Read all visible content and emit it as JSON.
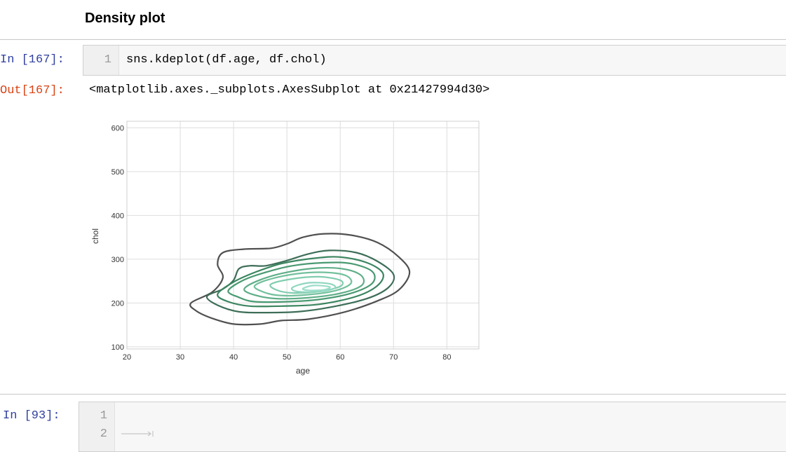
{
  "markdown": {
    "heading": "Density plot"
  },
  "cell_167": {
    "in_prompt": "In [167]:",
    "line_numbers": [
      "1"
    ],
    "code": "sns.kdeplot(df.age, df.chol)",
    "out_prompt": "Out[167]:",
    "output_text": "<matplotlib.axes._subplots.AxesSubplot at 0x21427994d30>"
  },
  "cell_93": {
    "in_prompt": "In [93]:",
    "line_numbers": [
      "1",
      "2"
    ],
    "code_lines": [
      "",
      ""
    ]
  },
  "colors": {
    "in_prompt": "#303f9f",
    "out_prompt": "#d84315",
    "contour_outer": "#505050",
    "contour_inner": "#8fd6c0"
  },
  "chart_data": {
    "type": "kde-contour",
    "title": "",
    "xlabel": "age",
    "ylabel": "chol",
    "xlim": [
      20,
      86
    ],
    "ylim": [
      95,
      615
    ],
    "xticks": [
      20,
      30,
      40,
      50,
      60,
      70,
      80
    ],
    "yticks": [
      100,
      200,
      300,
      400,
      500,
      600
    ],
    "grid": true,
    "contours": [
      {
        "level": 1,
        "color": "#505050",
        "points": [
          [
            32,
            200
          ],
          [
            36,
            225
          ],
          [
            38,
            258
          ],
          [
            37,
            288
          ],
          [
            38,
            315
          ],
          [
            42,
            323
          ],
          [
            47,
            325
          ],
          [
            50,
            335
          ],
          [
            53,
            350
          ],
          [
            57,
            358
          ],
          [
            62,
            355
          ],
          [
            67,
            338
          ],
          [
            71,
            305
          ],
          [
            73,
            270
          ],
          [
            71,
            230
          ],
          [
            67,
            205
          ],
          [
            61,
            180
          ],
          [
            54,
            163
          ],
          [
            49,
            160
          ],
          [
            45,
            152
          ],
          [
            40,
            152
          ],
          [
            36,
            165
          ],
          [
            33,
            182
          ]
        ]
      },
      {
        "level": 2,
        "color": "#3d6e58",
        "points": [
          [
            35,
            215
          ],
          [
            38,
            232
          ],
          [
            40,
            252
          ],
          [
            41,
            278
          ],
          [
            43,
            285
          ],
          [
            46,
            285
          ],
          [
            50,
            297
          ],
          [
            54,
            312
          ],
          [
            58,
            320
          ],
          [
            63,
            315
          ],
          [
            67,
            295
          ],
          [
            70,
            265
          ],
          [
            69,
            235
          ],
          [
            65,
            210
          ],
          [
            58,
            190
          ],
          [
            52,
            180
          ],
          [
            46,
            178
          ],
          [
            41,
            180
          ],
          [
            37,
            195
          ]
        ]
      },
      {
        "level": 3,
        "color": "#3b8560",
        "points": [
          [
            37,
            220
          ],
          [
            40,
            248
          ],
          [
            44,
            270
          ],
          [
            49,
            290
          ],
          [
            55,
            302
          ],
          [
            60,
            305
          ],
          [
            65,
            292
          ],
          [
            68,
            268
          ],
          [
            67,
            240
          ],
          [
            63,
            215
          ],
          [
            56,
            197
          ],
          [
            49,
            193
          ],
          [
            43,
            193
          ],
          [
            39,
            203
          ]
        ]
      },
      {
        "level": 4,
        "color": "#4a9a72",
        "points": [
          [
            39,
            228
          ],
          [
            42,
            253
          ],
          [
            46,
            270
          ],
          [
            51,
            285
          ],
          [
            57,
            292
          ],
          [
            62,
            290
          ],
          [
            66,
            272
          ],
          [
            66,
            245
          ],
          [
            62,
            222
          ],
          [
            56,
            208
          ],
          [
            50,
            203
          ],
          [
            44,
            203
          ],
          [
            41,
            213
          ]
        ]
      },
      {
        "level": 5,
        "color": "#5fae88",
        "points": [
          [
            42,
            232
          ],
          [
            45,
            253
          ],
          [
            50,
            270
          ],
          [
            56,
            280
          ],
          [
            61,
            277
          ],
          [
            64,
            262
          ],
          [
            64,
            240
          ],
          [
            60,
            222
          ],
          [
            54,
            212
          ],
          [
            48,
            210
          ],
          [
            44,
            218
          ]
        ]
      },
      {
        "level": 6,
        "color": "#72c09c",
        "points": [
          [
            44,
            240
          ],
          [
            47,
            255
          ],
          [
            52,
            267
          ],
          [
            57,
            270
          ],
          [
            61,
            263
          ],
          [
            62,
            245
          ],
          [
            59,
            228
          ],
          [
            53,
            218
          ],
          [
            48,
            218
          ],
          [
            45,
            228
          ]
        ]
      },
      {
        "level": 7,
        "color": "#82cdaf",
        "points": [
          [
            47,
            243
          ],
          [
            51,
            255
          ],
          [
            56,
            260
          ],
          [
            60,
            252
          ],
          [
            60,
            238
          ],
          [
            56,
            226
          ],
          [
            51,
            223
          ],
          [
            48,
            230
          ]
        ]
      },
      {
        "level": 8,
        "color": "#8fd6c0",
        "points": [
          [
            51,
            235
          ],
          [
            54,
            246
          ],
          [
            58,
            244
          ],
          [
            59,
            234
          ],
          [
            56,
            226
          ],
          [
            52,
            226
          ]
        ]
      },
      {
        "level": 9,
        "color": "#9addc8",
        "points": [
          [
            53,
            233
          ],
          [
            55,
            240
          ],
          [
            58,
            237
          ],
          [
            57,
            230
          ],
          [
            54,
            229
          ]
        ]
      }
    ]
  }
}
